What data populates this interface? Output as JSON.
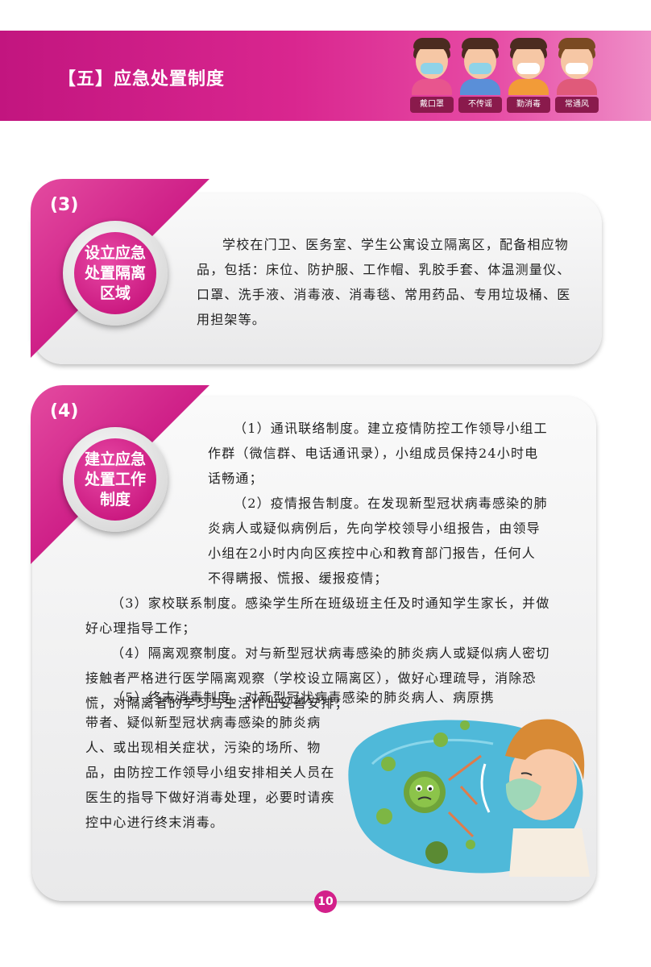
{
  "header": {
    "title": "【五】应急处置制度",
    "kids": [
      {
        "tag": "戴口罩"
      },
      {
        "tag": "不传谣"
      },
      {
        "tag": "勤消毒"
      },
      {
        "tag": "常通风"
      }
    ]
  },
  "section3": {
    "number": "(3)",
    "badge": "设立应急处置隔离区域",
    "text": "学校在门卫、医务室、学生公寓设立隔离区，配备相应物品，包括：床位、防护服、工作帽、乳胶手套、体温测量仪、口罩、洗手液、消毒液、消毒毯、常用药品、专用垃圾桶、医用担架等。"
  },
  "section4": {
    "number": "(4)",
    "badge": "建立应急处置工作制度",
    "p1": "（1）通讯联络制度。建立疫情防控工作领导小组工作群（微信群、电话通讯录），小组成员保持24小时电话畅通；",
    "p2": "（2）疫情报告制度。在发现新型冠状病毒感染的肺炎病人或疑似病例后，先向学校领导小组报告，由领导小组在2小时内向区疾控中心和教育部门报告，任何人不得瞒报、慌报、缓报疫情；",
    "p3": "（3）家校联系制度。感染学生所在班级班主任及时通知学生家长，并做好心理指导工作；",
    "p4": "（4）隔离观察制度。对与新型冠状病毒感染的肺炎病人或疑似病人密切接触者严格进行医学隔离观察（学校设立隔离区），做好心理疏导，消除恐慌，对隔离者的学习与生活作出妥善安排；",
    "p5a": "（5）终末消毒制度。对新型冠状病毒感染的肺炎病人、病原携",
    "p5b": "带者、疑似新型冠状病毒感染的肺炎病人、或出现相关症状，污染的场所、物品，由防控工作领导小组安排相关人员在医生的指导下做好消毒处理，必要时请疾控中心进行终末消毒。"
  },
  "page_number": "10",
  "colors": {
    "accent": "#d3208a",
    "banner_dark": "#c2157f",
    "card_bg": "#f2f2f3"
  }
}
